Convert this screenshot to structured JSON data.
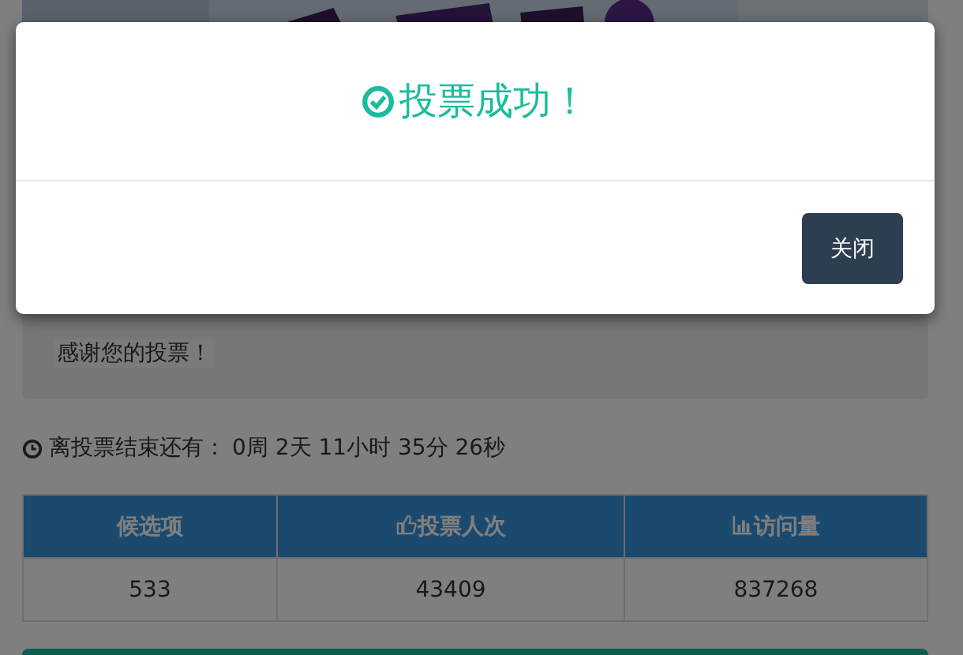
{
  "notice": {
    "text": "感谢您的投票！"
  },
  "countdown": {
    "label": "离投票结束还有：",
    "value": "0周 2天 11小时 35分 26秒"
  },
  "table": {
    "columns": [
      {
        "label": "候选项",
        "kind": "plain"
      },
      {
        "label": "投票人次",
        "kind": "votes"
      },
      {
        "label": "访问量",
        "kind": "visits"
      }
    ],
    "rows": [
      [
        "533",
        "43409",
        "837268"
      ]
    ]
  },
  "modal": {
    "message": "投票成功！",
    "close_button": "关闭"
  }
}
